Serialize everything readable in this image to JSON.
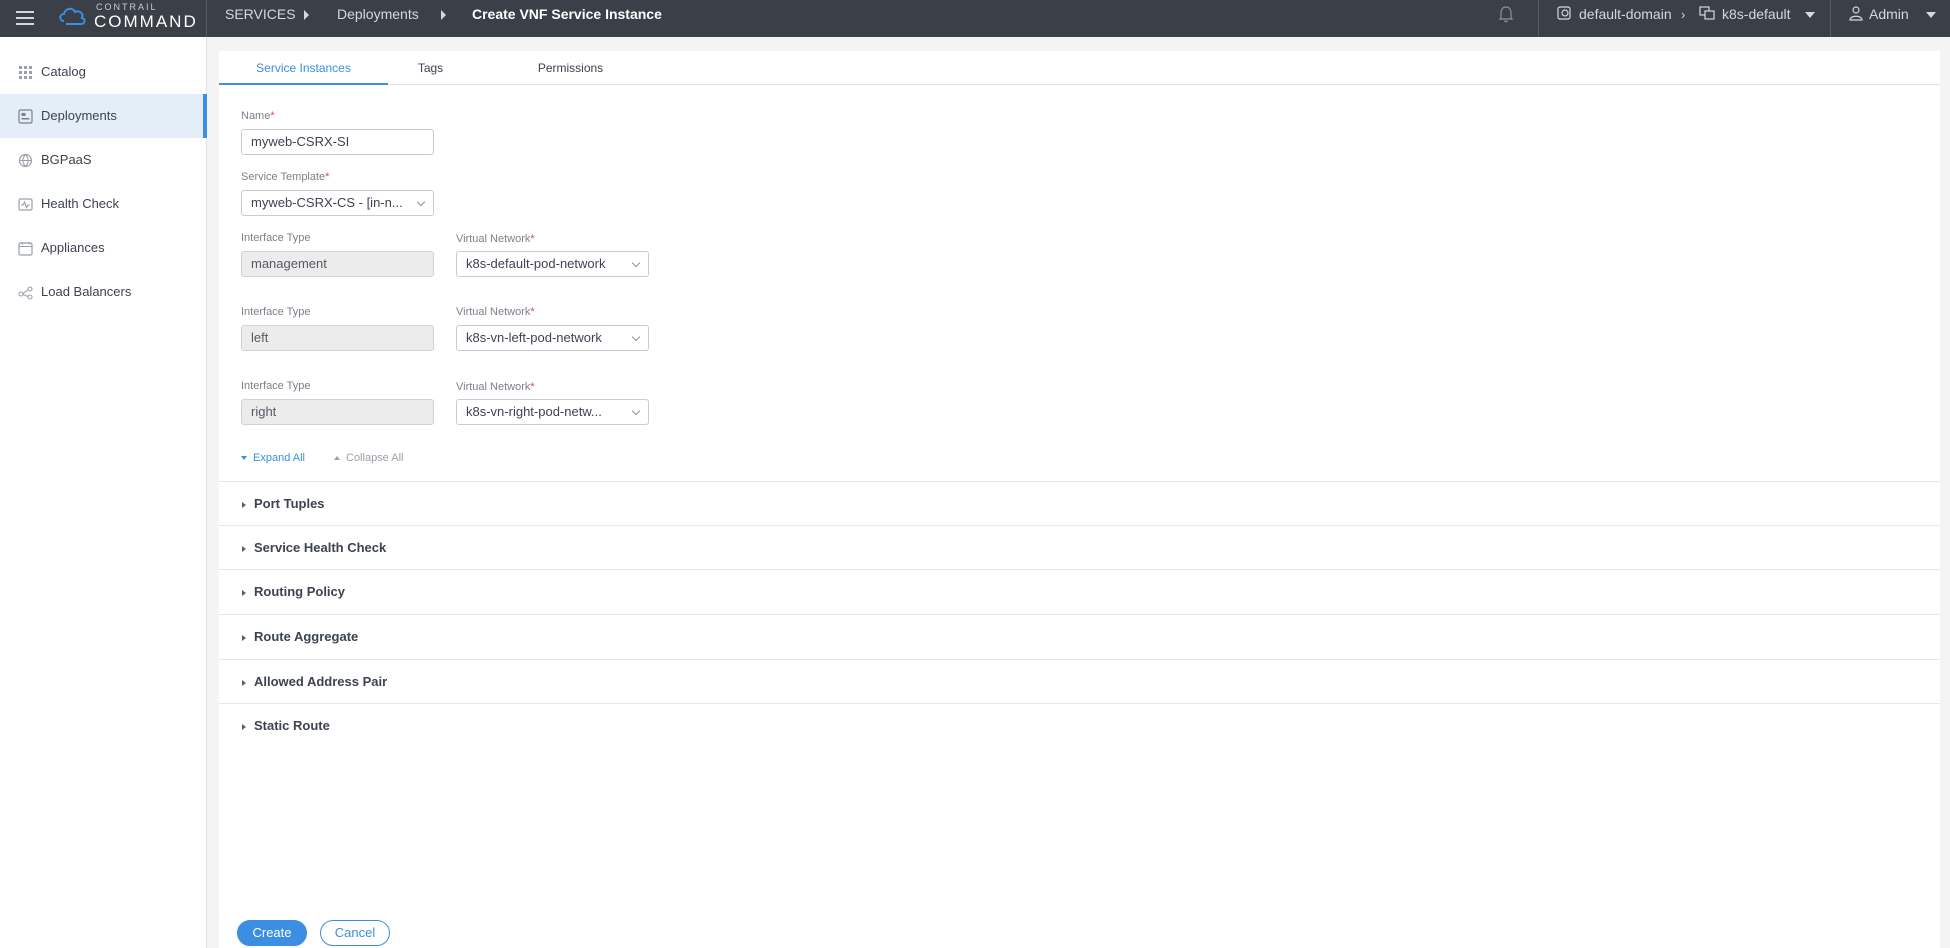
{
  "topbar": {
    "logo_small": "CONTRAIL",
    "logo_big": "COMMAND",
    "breadcrumbs": [
      "SERVICES",
      "Deployments",
      "Create VNF Service Instance"
    ],
    "domain": "default-domain",
    "project": "k8s-default",
    "user": "Admin"
  },
  "sidebar": {
    "items": [
      {
        "label": "Catalog",
        "icon": "grid-icon"
      },
      {
        "label": "Deployments",
        "icon": "deployments-icon"
      },
      {
        "label": "BGPaaS",
        "icon": "globe-icon"
      },
      {
        "label": "Health Check",
        "icon": "pulse-icon"
      },
      {
        "label": "Appliances",
        "icon": "calendar-box-icon"
      },
      {
        "label": "Load Balancers",
        "icon": "share-node-icon"
      }
    ]
  },
  "tabs": [
    "Service Instances",
    "Tags",
    "Permissions"
  ],
  "form": {
    "name_label": "Name",
    "name_value": "myweb-CSRX-SI",
    "template_label": "Service Template",
    "template_value": "myweb-CSRX-CS - [in-n...",
    "interfaces": [
      {
        "type_label": "Interface Type",
        "type_value": "management",
        "vn_label": "Virtual Network",
        "vn_value": "k8s-default-pod-network"
      },
      {
        "type_label": "Interface Type",
        "type_value": "left",
        "vn_label": "Virtual Network",
        "vn_value": "k8s-vn-left-pod-network"
      },
      {
        "type_label": "Interface Type",
        "type_value": "right",
        "vn_label": "Virtual Network",
        "vn_value": "k8s-vn-right-pod-netw..."
      }
    ],
    "required_mark": "*"
  },
  "expand_all": "Expand All",
  "collapse_all": "Collapse All",
  "sections": [
    "Port Tuples",
    "Service Health Check",
    "Routing Policy",
    "Route Aggregate",
    "Allowed Address Pair",
    "Static Route"
  ],
  "buttons": {
    "create": "Create",
    "cancel": "Cancel"
  },
  "colors": {
    "topbar": "#3a3f48",
    "accent": "#3b8ee1",
    "required": "#e0454b"
  }
}
